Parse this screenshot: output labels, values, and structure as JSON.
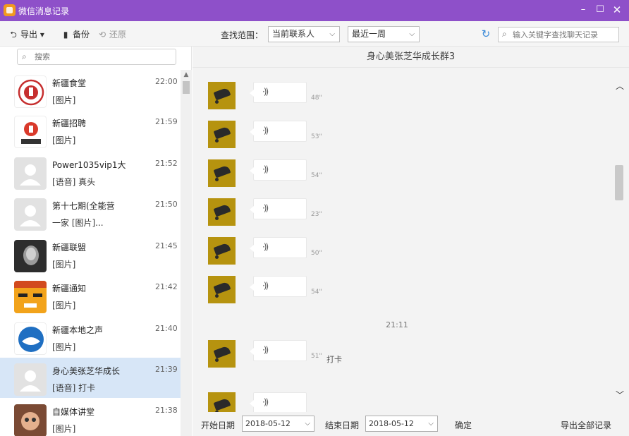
{
  "app": {
    "title": "微信消息记录"
  },
  "window": {
    "min": "–",
    "max": "☐",
    "close": "✕"
  },
  "toolbar": {
    "export_label": "导出",
    "backup_label": "备份",
    "restore_label": "还原",
    "range_label": "查找范围：",
    "contact_select": "当前联系人",
    "time_select": "最近一周",
    "search_placeholder": "输入关键字查找聊天记录"
  },
  "left": {
    "search_placeholder": "搜索",
    "contacts": [
      {
        "name": "新疆食堂",
        "msg": "[图片]",
        "time": "22:00"
      },
      {
        "name": "新疆招聘",
        "msg": "[图片]",
        "time": "21:59"
      },
      {
        "name": "Power1035vip1大",
        "msg": "[语音] 真头",
        "time": "21:52"
      },
      {
        "name": "第十七期(全能营",
        "msg": "一家 [图片]...",
        "time": "21:50"
      },
      {
        "name": "新疆联盟",
        "msg": "[图片]",
        "time": "21:45"
      },
      {
        "name": "新疆通知",
        "msg": "[图片]",
        "time": "21:42"
      },
      {
        "name": "新疆本地之声",
        "msg": "[图片]",
        "time": "21:40"
      },
      {
        "name": "身心美张芝华成长",
        "msg": "[语音] 打卡",
        "time": "21:39"
      },
      {
        "name": "自媒体讲堂",
        "msg": "[图片]",
        "time": "21:38"
      }
    ]
  },
  "chat": {
    "title": "身心美张芝华成长群3",
    "time_separator": "21:11",
    "messages": [
      {
        "duration": "48\"",
        "tag": ""
      },
      {
        "duration": "53\"",
        "tag": ""
      },
      {
        "duration": "54\"",
        "tag": ""
      },
      {
        "duration": "23\"",
        "tag": ""
      },
      {
        "duration": "50\"",
        "tag": ""
      },
      {
        "duration": "54\"",
        "tag": ""
      },
      {
        "duration": "51\"",
        "tag": "打卡"
      },
      {
        "duration": "",
        "tag": ""
      }
    ]
  },
  "bottom": {
    "start_label": "开始日期",
    "start_date": "2018-05-12",
    "end_label": "结束日期",
    "end_date": "2018-05-12",
    "confirm_label": "确定",
    "export_all_label": "导出全部记录"
  },
  "colors": {
    "titlebar": "#8e50c9",
    "selected_row": "#d7e6f7",
    "accent_blue": "#3b8ad8",
    "voice_avatar": "#b6930f"
  }
}
